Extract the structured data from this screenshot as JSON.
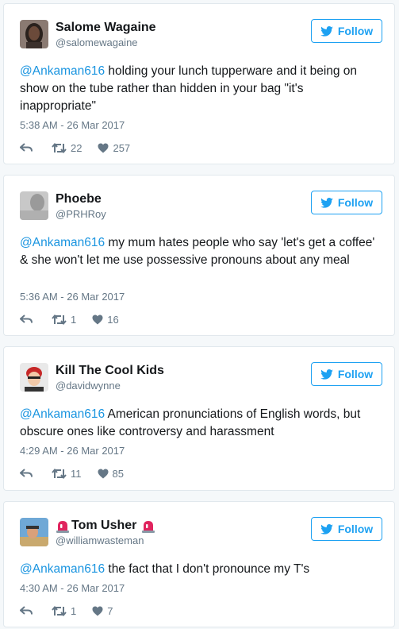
{
  "follow_label": "Follow",
  "colors": {
    "accent": "#1da1f2",
    "mention": "#1b95e0",
    "muted": "#657786",
    "siren": "#e0245e"
  },
  "tweets": [
    {
      "name": "Salome Wagaine",
      "handle": "@salomewagaine",
      "mention": "@Ankaman616",
      "text": " holding your lunch tupperware and it being on show on the tube rather than hidden in your bag \"it's inappropriate\"",
      "time": "5:38 AM - 26 Mar 2017",
      "retweets": "22",
      "likes": "257"
    },
    {
      "name": "Phoebe",
      "handle": "@PRHRoy",
      "mention": "@Ankaman616",
      "text": " my mum hates people who say 'let's get a coffee' & she won't let me use possessive pronouns about any meal",
      "time": "5:36 AM - 26 Mar 2017",
      "retweets": "1",
      "likes": "16"
    },
    {
      "name": "Kill The Cool Kids",
      "handle": "@davidwynne",
      "mention": "@Ankaman616",
      "text": " American pronunciations of English words, but obscure ones like controversy and harassment",
      "time": "4:29 AM - 26 Mar 2017",
      "retweets": "11",
      "likes": "85"
    },
    {
      "name": "Tom Usher",
      "handle": "@williamwasteman",
      "mention": "@Ankaman616",
      "text": " the fact that I don't pronounce my T's",
      "time": "4:30 AM - 26 Mar 2017",
      "retweets": "1",
      "likes": "7"
    }
  ]
}
